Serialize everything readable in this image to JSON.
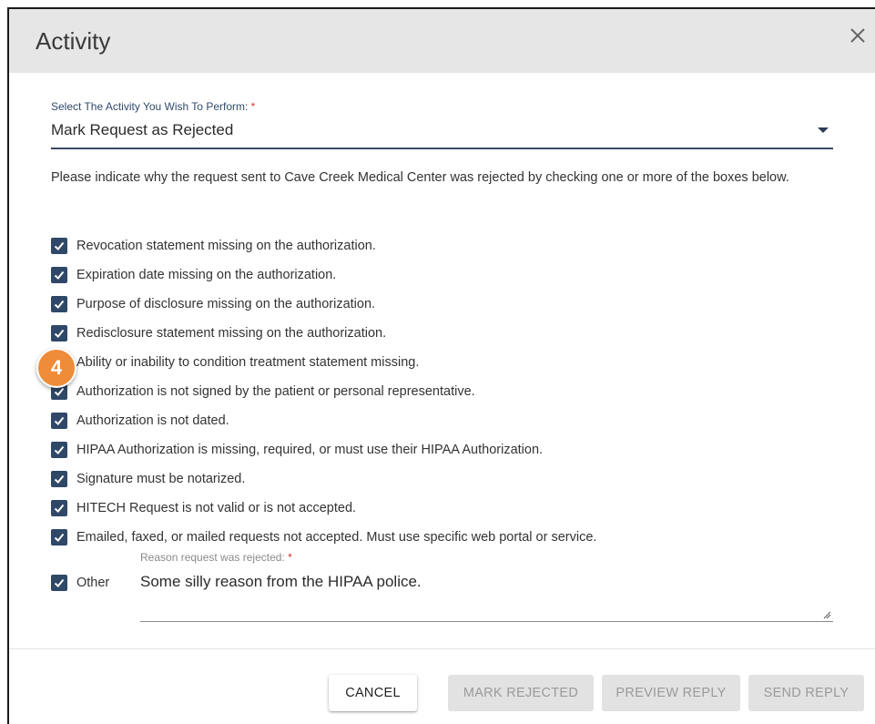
{
  "dialog": {
    "title": "Activity"
  },
  "activity_select": {
    "label": "Select The Activity You Wish To Perform:",
    "required_mark": "*",
    "value": "Mark Request as Rejected"
  },
  "instructions": "Please indicate why the request sent to Cave Creek Medical Center was rejected by checking one or more of the boxes below.",
  "reasons": [
    {
      "label": "Revocation statement missing on the authorization.",
      "checked": true
    },
    {
      "label": "Expiration date missing on the authorization.",
      "checked": true
    },
    {
      "label": "Purpose of disclosure missing on the authorization.",
      "checked": true
    },
    {
      "label": "Redisclosure statement missing on the authorization.",
      "checked": true
    },
    {
      "label": "Ability or inability to condition treatment statement missing.",
      "checked": true
    },
    {
      "label": "Authorization is not signed by the patient or personal representative.",
      "checked": true
    },
    {
      "label": "Authorization is not dated.",
      "checked": true
    },
    {
      "label": "HIPAA Authorization is missing, required, or must use their HIPAA Authorization.",
      "checked": true
    },
    {
      "label": "Signature must be notarized.",
      "checked": true
    },
    {
      "label": "HITECH Request is not valid or is not accepted.",
      "checked": true
    },
    {
      "label": "Emailed, faxed, or mailed requests not accepted. Must use specific web portal or service.",
      "checked": true
    },
    {
      "label": "Other",
      "checked": true
    }
  ],
  "other_reason": {
    "label": "Reason request was rejected:",
    "required_mark": "*",
    "value": "Some silly reason from the HIPAA police."
  },
  "step_badge": "4",
  "buttons": {
    "cancel": "CANCEL",
    "mark_rejected": "MARK REJECTED",
    "preview_reply": "PREVIEW REPLY",
    "send_reply": "SEND REPLY"
  },
  "colors": {
    "checkbox": "#2f4868",
    "badge": "#ee8c39",
    "header_bg": "#e6e6e6",
    "required": "#d9342b"
  }
}
